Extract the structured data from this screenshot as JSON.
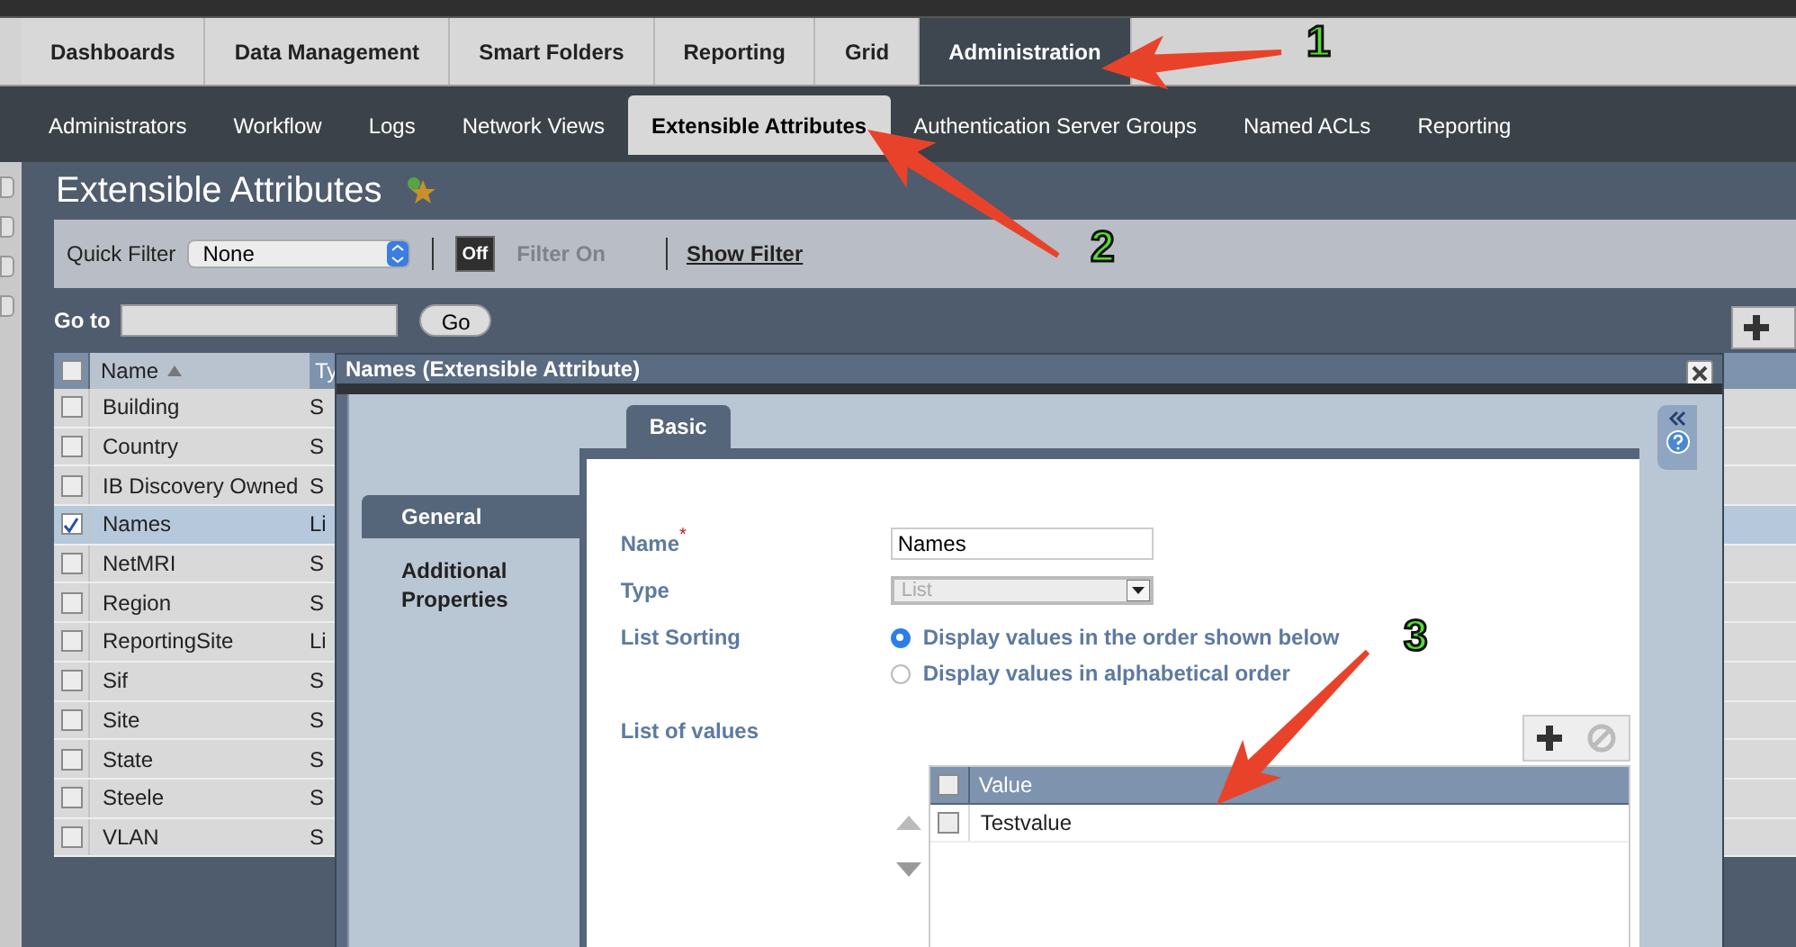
{
  "top_tabs": [
    {
      "label": "Dashboards",
      "selected": false
    },
    {
      "label": "Data Management",
      "selected": false
    },
    {
      "label": "Smart Folders",
      "selected": false
    },
    {
      "label": "Reporting",
      "selected": false
    },
    {
      "label": "Grid",
      "selected": false
    },
    {
      "label": "Administration",
      "selected": true
    }
  ],
  "sub_tabs": [
    {
      "label": "Administrators",
      "selected": false
    },
    {
      "label": "Workflow",
      "selected": false
    },
    {
      "label": "Logs",
      "selected": false
    },
    {
      "label": "Network Views",
      "selected": false
    },
    {
      "label": "Extensible Attributes",
      "selected": true
    },
    {
      "label": "Authentication Server Groups",
      "selected": false
    },
    {
      "label": "Named ACLs",
      "selected": false
    },
    {
      "label": "Reporting",
      "selected": false
    }
  ],
  "page": {
    "title": "Extensible Attributes",
    "quick_filter": {
      "label": "Quick Filter",
      "value": "None"
    },
    "filter_toggle": {
      "label": "Off",
      "on": false
    },
    "filter_on_label": "Filter On",
    "show_filter": "Show Filter",
    "goto": {
      "label": "Go to",
      "button": "Go"
    }
  },
  "table": {
    "columns": [
      "Name",
      "Ty"
    ],
    "all_checked": false,
    "rows": [
      {
        "name": "Building",
        "type": "S",
        "checked": false,
        "selected": false
      },
      {
        "name": "Country",
        "type": "S",
        "checked": false,
        "selected": false
      },
      {
        "name": "IB Discovery Owned",
        "type": "S",
        "checked": false,
        "selected": false
      },
      {
        "name": "Names",
        "type": "Li",
        "checked": true,
        "selected": true
      },
      {
        "name": "NetMRI",
        "type": "S",
        "checked": false,
        "selected": false
      },
      {
        "name": "Region",
        "type": "S",
        "checked": false,
        "selected": false
      },
      {
        "name": "ReportingSite",
        "type": "Li",
        "checked": false,
        "selected": false
      },
      {
        "name": "Sif",
        "type": "S",
        "checked": false,
        "selected": false
      },
      {
        "name": "Site",
        "type": "S",
        "checked": false,
        "selected": false
      },
      {
        "name": "State",
        "type": "S",
        "checked": false,
        "selected": false
      },
      {
        "name": "Steele",
        "type": "S",
        "checked": false,
        "selected": false
      },
      {
        "name": "VLAN",
        "type": "S",
        "checked": false,
        "selected": false
      }
    ]
  },
  "dialog": {
    "title": "Names (Extensible Attribute)",
    "nav": [
      {
        "label": "General",
        "selected": true
      },
      {
        "label": "Additional Properties",
        "selected": false
      }
    ],
    "tabs": [
      {
        "label": "Basic",
        "selected": true
      }
    ],
    "name_field": {
      "label": "Name",
      "required_mark": "*",
      "value": "Names"
    },
    "type_field": {
      "label": "Type",
      "value": "List",
      "disabled": true
    },
    "list_sorting": {
      "label": "List Sorting",
      "options": [
        {
          "label": "Display values in the order shown below",
          "selected": true
        },
        {
          "label": "Display values in alphabetical order",
          "selected": false
        }
      ]
    },
    "list_of_values": {
      "label": "List of values",
      "column": "Value",
      "all_checked": false,
      "rows": [
        {
          "value": "Testvalue",
          "checked": false
        }
      ]
    }
  },
  "annotations": [
    "1",
    "2",
    "3"
  ]
}
